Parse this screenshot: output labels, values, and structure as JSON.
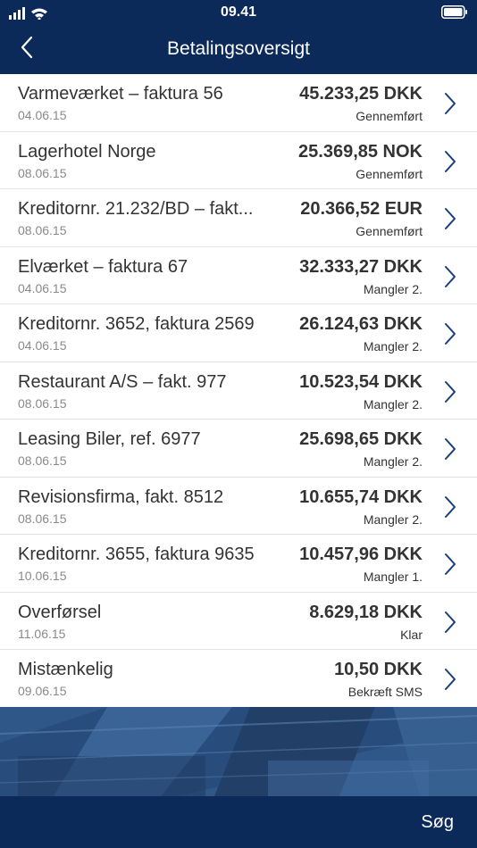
{
  "status_bar": {
    "time": "09.41"
  },
  "header": {
    "title": "Betalingsoversigt"
  },
  "payments": [
    {
      "name": "Varmeværket – faktura 56",
      "date": "04.06.15",
      "amount": "45.233,25 DKK",
      "status": "Gennemført"
    },
    {
      "name": "Lagerhotel Norge",
      "date": "08.06.15",
      "amount": "25.369,85 NOK",
      "status": "Gennemført"
    },
    {
      "name": "Kreditornr. 21.232/BD – fakt...",
      "date": "08.06.15",
      "amount": "20.366,52 EUR",
      "status": "Gennemført"
    },
    {
      "name": "Elværket – faktura 67",
      "date": "04.06.15",
      "amount": "32.333,27 DKK",
      "status": "Mangler 2."
    },
    {
      "name": "Kreditornr. 3652, faktura 2569",
      "date": "04.06.15",
      "amount": "26.124,63 DKK",
      "status": "Mangler 2."
    },
    {
      "name": "Restaurant A/S – fakt. 977",
      "date": "08.06.15",
      "amount": "10.523,54 DKK",
      "status": "Mangler 2."
    },
    {
      "name": "Leasing Biler, ref. 6977",
      "date": "08.06.15",
      "amount": "25.698,65 DKK",
      "status": "Mangler 2."
    },
    {
      "name": "Revisionsfirma, fakt. 8512",
      "date": "08.06.15",
      "amount": "10.655,74 DKK",
      "status": "Mangler 2."
    },
    {
      "name": "Kreditornr. 3655, faktura 9635",
      "date": "10.06.15",
      "amount": "10.457,96 DKK",
      "status": "Mangler 1."
    },
    {
      "name": "Overførsel",
      "date": "11.06.15",
      "amount": "8.629,18 DKK",
      "status": "Klar"
    },
    {
      "name": "Mistænkelig",
      "date": "09.06.15",
      "amount": "10,50 DKK",
      "status": "Bekræft SMS"
    }
  ],
  "footer": {
    "search_label": "Søg"
  },
  "colors": {
    "navy": "#0b2a5a",
    "chevron": "#1a3f78",
    "banner": "#2f5788"
  }
}
